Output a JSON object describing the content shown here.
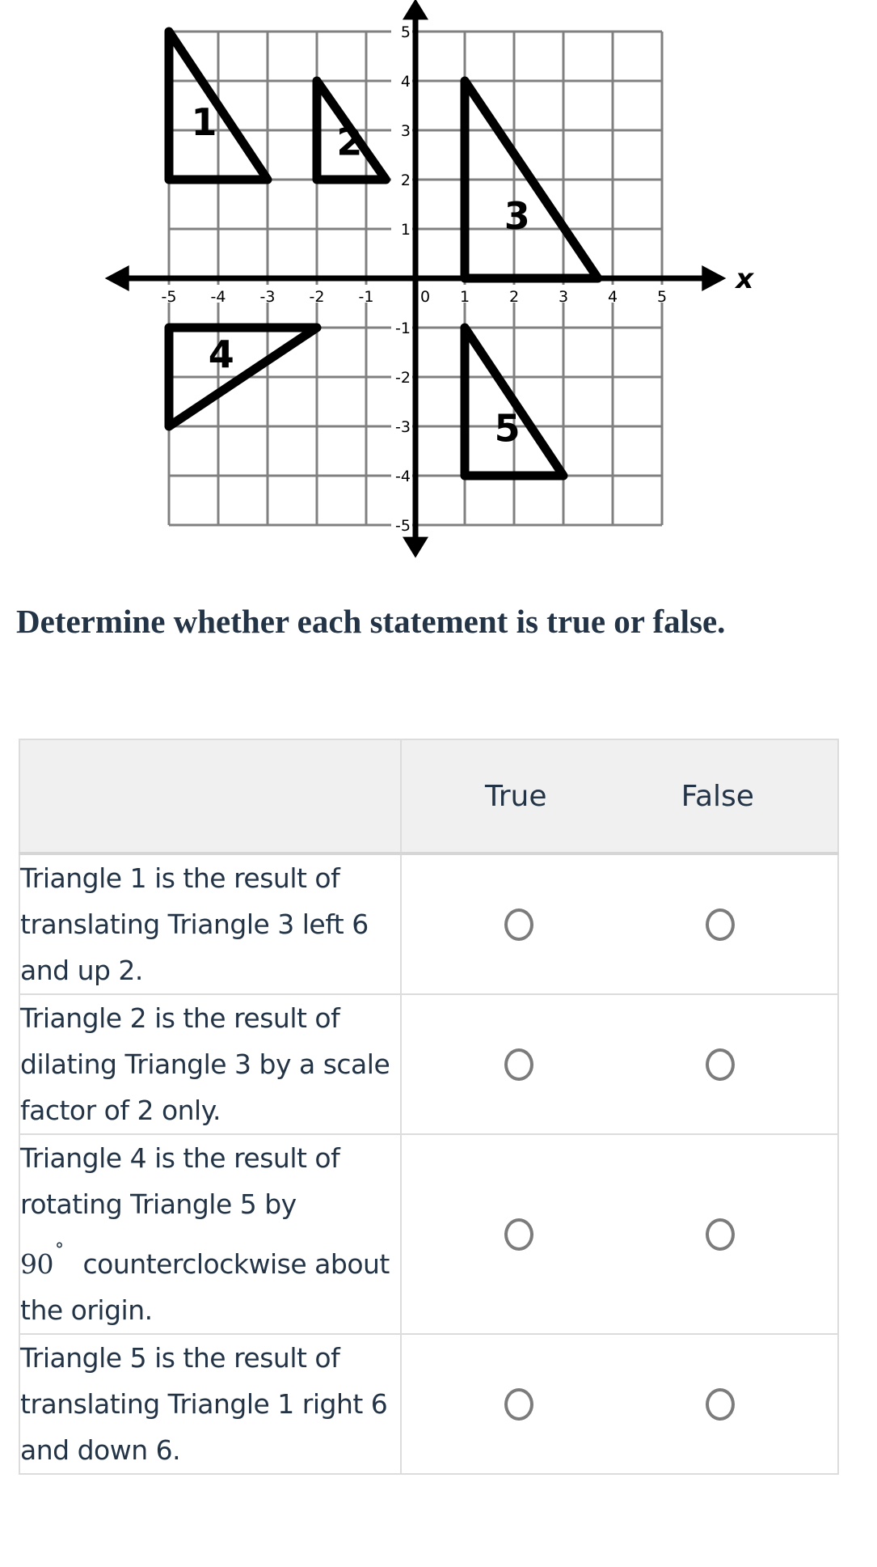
{
  "chart_data": {
    "type": "diagram",
    "title": "",
    "xlabel": "x",
    "ylabel": "",
    "xlim": [
      -5,
      5
    ],
    "ylim": [
      -5,
      5
    ],
    "grid": true,
    "x_ticks": [
      "-5",
      "-4",
      "-3",
      "-2",
      "-1",
      "0",
      "1",
      "2",
      "3",
      "4",
      "5"
    ],
    "y_ticks": [
      "5",
      "4",
      "3",
      "2",
      "1",
      "-1",
      "-2",
      "-3",
      "-4",
      "-5"
    ],
    "triangles": [
      {
        "label": "1",
        "vertices": [
          [
            -5,
            5
          ],
          [
            -5,
            2
          ],
          [
            -3,
            2
          ]
        ],
        "label_at": [
          -4.55,
          2.9
        ]
      },
      {
        "label": "2",
        "vertices": [
          [
            -2,
            4
          ],
          [
            -2,
            2
          ],
          [
            -0.6,
            2
          ]
        ],
        "label_at": [
          -1.6,
          2.5
        ]
      },
      {
        "label": "3",
        "vertices": [
          [
            1,
            4
          ],
          [
            1,
            0
          ],
          [
            3.7,
            0
          ]
        ],
        "label_at": [
          1.8,
          1.0
        ]
      },
      {
        "label": "4",
        "vertices": [
          [
            -5,
            -1
          ],
          [
            -5,
            -3
          ],
          [
            -2,
            -1
          ]
        ],
        "label_at": [
          -4.2,
          -1.8
        ]
      },
      {
        "label": "5",
        "vertices": [
          [
            1,
            -1
          ],
          [
            1,
            -4
          ],
          [
            3,
            -4
          ]
        ],
        "label_at": [
          1.6,
          -3.3
        ]
      }
    ]
  },
  "question": {
    "prompt": "Determine whether each statement is true or false."
  },
  "table": {
    "columns": [
      "",
      "True",
      "False"
    ],
    "rows": [
      {
        "statement": "Triangle 1 is the result of translating Triangle 3 left 6 and up 2.",
        "selected": null
      },
      {
        "statement": "Triangle 2 is the result of dilating Triangle 3 by a scale factor of 2 only.",
        "selected": null
      },
      {
        "statement_pre": "Triangle 4 is the result of rotating Triangle 5 by",
        "math": "90",
        "degree": "°",
        "statement_post": "counterclockwise about the origin.",
        "selected": null
      },
      {
        "statement": "Triangle 5 is the result of translating Triangle 1 right 6 and down 6.",
        "selected": null
      }
    ]
  },
  "colors": {
    "text": "#243447",
    "grid": "#808080",
    "axis": "#000000",
    "header_bg": "#f0f0f0",
    "radio_border": "#7c7c7c"
  }
}
